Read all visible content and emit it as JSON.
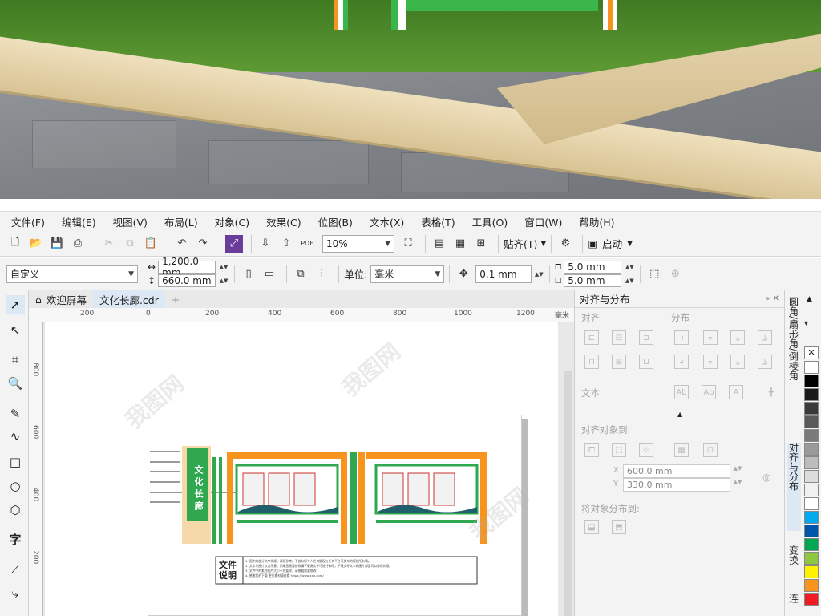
{
  "menu": [
    "文件(F)",
    "编辑(E)",
    "视图(V)",
    "布局(L)",
    "对象(C)",
    "效果(C)",
    "位图(B)",
    "文本(X)",
    "表格(T)",
    "工具(O)",
    "窗口(W)",
    "帮助(H)"
  ],
  "toolbar1": {
    "zoom": "10%",
    "snap_label": "贴齐(T)",
    "launch_label": "启动"
  },
  "toolbar2": {
    "preset": "自定义",
    "width": "1,200.0 mm",
    "height": "660.0 mm",
    "unit_label": "单位:",
    "unit_value": "毫米",
    "nudge": "0.1 mm",
    "dup_x": "5.0 mm",
    "dup_y": "5.0 mm"
  },
  "tabs": {
    "welcome": "欢迎屏幕",
    "doc": "文化长廊.cdr"
  },
  "ruler": {
    "h_ticks": [
      "200",
      "0",
      "200",
      "400",
      "600",
      "800",
      "1000",
      "1200"
    ],
    "h_unit": "毫米",
    "v_ticks": [
      "800",
      "600",
      "400",
      "200"
    ]
  },
  "artwork": {
    "banner_text": "文化长廊",
    "note_title": "文件说明",
    "note_lines": [
      "1.  图中的部分文字排版，请您参考。不含有您个人任何版权与任何平台可发布的版权所有哦。",
      "2.  文字与图片仅为示意。如果您需要修改请下载源文件可进行修改，下载文件文字和图片都是可以修改的哦。",
      "3.  文件中的素材图片大小不在要求，请根据需要修改",
      "4.  感谢您的下载  更多素材请查看  https://www.xxx.com/"
    ]
  },
  "right_panel": {
    "title": "对齐与分布",
    "align_label": "对齐",
    "distribute_label": "分布",
    "text_label": "文本",
    "align_to_label": "对齐对象到:",
    "x_value": "600.0 mm",
    "y_value": "330.0 mm",
    "distribute_to_label": "将对象分布到:"
  },
  "vtabs": [
    "圆角/扇形角/倒棱角",
    "对齐与分布",
    "变换",
    "连"
  ],
  "palette_colors": [
    "#ffffff",
    "#000000",
    "#1a1a1a",
    "#3a3a3a",
    "#5a5a5a",
    "#7a7a7a",
    "#9a9a9a",
    "#bdbdbd",
    "#dcdcdc",
    "#f0f0f0",
    "#ffffff",
    "#00aaee",
    "#0055aa",
    "#00a651",
    "#8dc63f",
    "#fff200",
    "#f7941d",
    "#ed1c24"
  ],
  "watermark": "我图网"
}
